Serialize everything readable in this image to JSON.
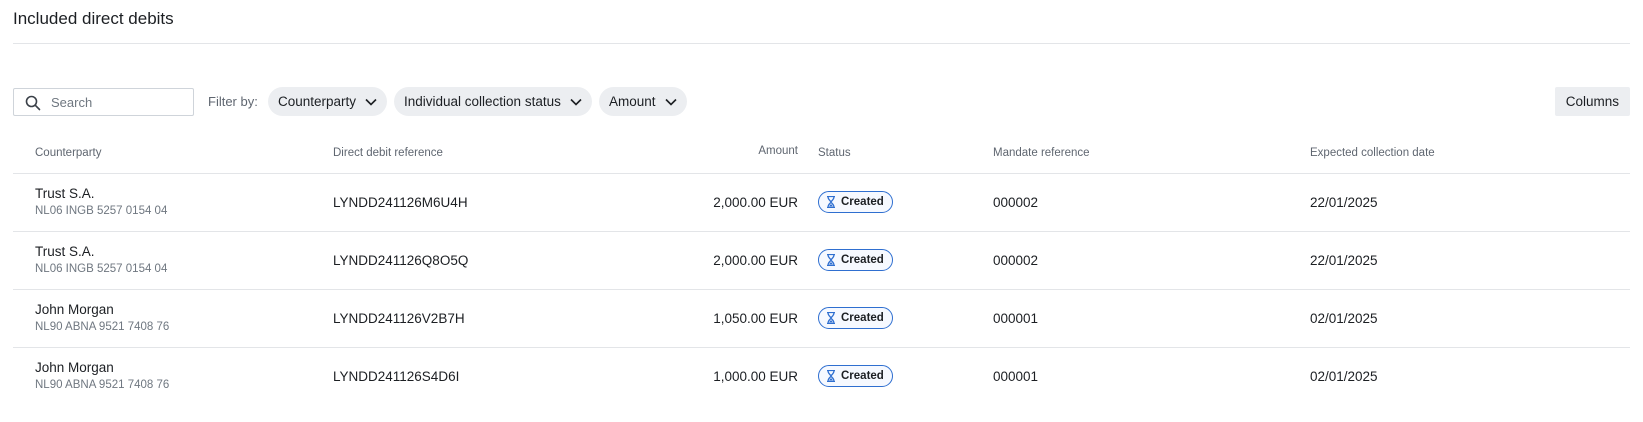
{
  "section": {
    "title": "Included direct debits"
  },
  "toolbar": {
    "search_placeholder": "Search",
    "filter_label": "Filter by:",
    "filters": [
      {
        "label": "Counterparty"
      },
      {
        "label": "Individual collection status"
      },
      {
        "label": "Amount"
      }
    ],
    "columns_label": "Columns"
  },
  "table": {
    "headers": {
      "counterparty": "Counterparty",
      "reference": "Direct debit reference",
      "amount": "Amount",
      "status": "Status",
      "mandate": "Mandate reference",
      "date": "Expected collection date"
    },
    "rows": [
      {
        "name": "Trust S.A.",
        "iban": "NL06 INGB 5257 0154 04",
        "reference": "LYNDD241126M6U4H",
        "amount": "2,000.00 EUR",
        "status": "Created",
        "mandate": "000002",
        "date": "22/01/2025"
      },
      {
        "name": "Trust S.A.",
        "iban": "NL06 INGB 5257 0154 04",
        "reference": "LYNDD241126Q8O5Q",
        "amount": "2,000.00 EUR",
        "status": "Created",
        "mandate": "000002",
        "date": "22/01/2025"
      },
      {
        "name": "John Morgan",
        "iban": "NL90 ABNA 9521 7408 76",
        "reference": "LYNDD241126V2B7H",
        "amount": "1,050.00 EUR",
        "status": "Created",
        "mandate": "000001",
        "date": "02/01/2025"
      },
      {
        "name": "John Morgan",
        "iban": "NL90 ABNA 9521 7408 76",
        "reference": "LYNDD241126S4D6I",
        "amount": "1,000.00 EUR",
        "status": "Created",
        "mandate": "000001",
        "date": "02/01/2025"
      }
    ]
  },
  "colors": {
    "badge_border": "#2f6fd0",
    "chip_bg": "#eceef1",
    "divider": "#e3e5e8"
  },
  "icons": {
    "search": "search-icon",
    "chevron": "chevron-down-icon",
    "status": "hourglass-icon"
  }
}
